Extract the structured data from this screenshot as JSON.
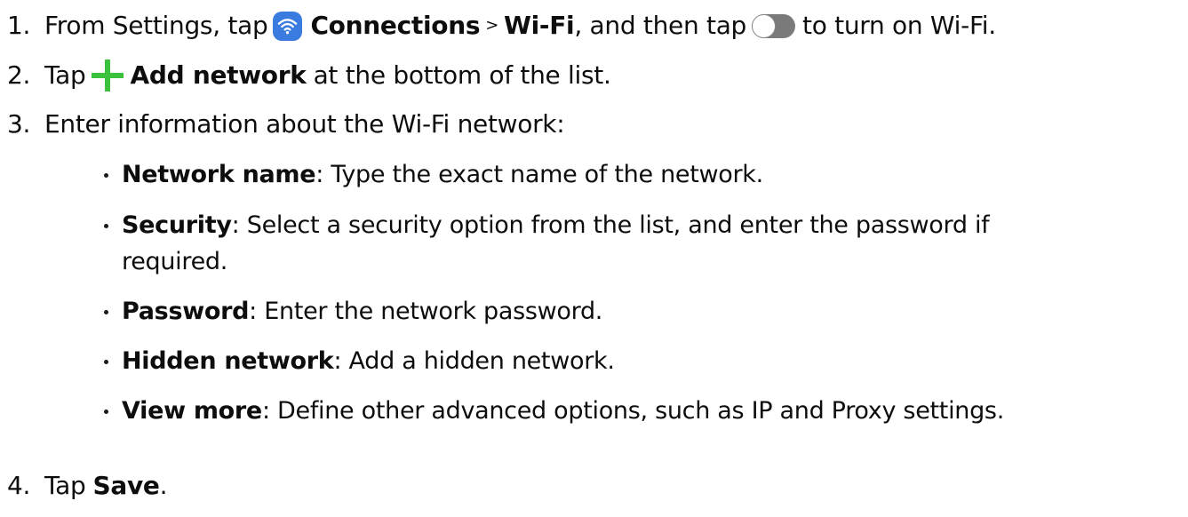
{
  "steps": [
    {
      "number": "1.",
      "t1": "From Settings, tap",
      "icon1": "wifi-icon",
      "b1": "Connections",
      "sep": ">",
      "b2": "Wi-Fi",
      "t2": ", and then tap",
      "icon2": "toggle-icon",
      "t3": "to turn on Wi-Fi."
    },
    {
      "number": "2.",
      "t1": "Tap",
      "icon1": "plus-icon",
      "b1": "Add network",
      "t2": "at the bottom of the list."
    },
    {
      "number": "3.",
      "t1": "Enter information about the Wi-Fi network:"
    },
    {
      "number": "4.",
      "t1": "Tap",
      "b1": "Save",
      "t2": "."
    }
  ],
  "bullets": [
    {
      "term": "Network name",
      "desc": ": Type the exact name of the network."
    },
    {
      "term": "Security",
      "desc": ": Select a security option from the list, and enter the password if",
      "desc2": "required."
    },
    {
      "term": "Password",
      "desc": ": Enter the network password."
    },
    {
      "term": "Hidden network",
      "desc": ": Add a hidden network."
    },
    {
      "term": "View more",
      "desc": ": Define other advanced options, such as IP and Proxy settings."
    }
  ],
  "colors": {
    "wifi_icon_bg": "#3a7be0",
    "plus_icon": "#3cc13c",
    "toggle_track": "#7a7a7a"
  }
}
